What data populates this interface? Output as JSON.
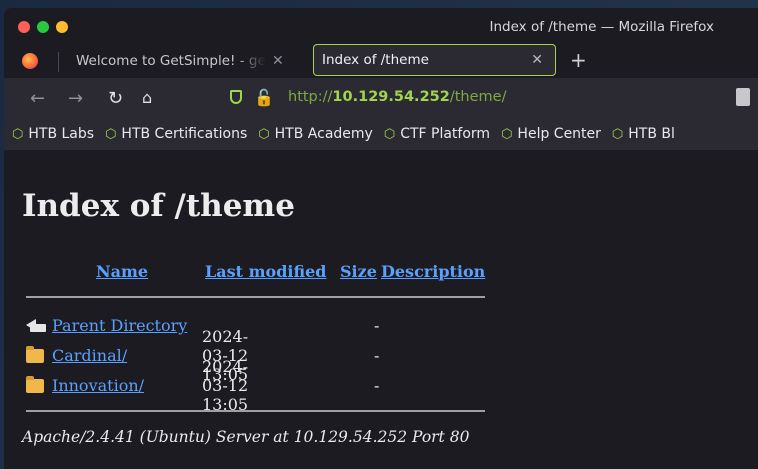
{
  "window": {
    "title": "Index of /theme — Mozilla Firefox"
  },
  "tabs": [
    {
      "label": "Welcome to GetSimple! - getsimple",
      "active": false
    },
    {
      "label": "Index of /theme",
      "active": true
    }
  ],
  "navbar": {
    "url_scheme": "http://",
    "url_host": "10.129.54.252",
    "url_path": "/theme/"
  },
  "bookmarks": [
    {
      "label": "HTB Labs",
      "icon": "htb-cube-icon"
    },
    {
      "label": "HTB Certifications",
      "icon": "htb-cube-icon"
    },
    {
      "label": "HTB Academy",
      "icon": "htb-cube-icon"
    },
    {
      "label": "CTF Platform",
      "icon": "htb-cube-icon"
    },
    {
      "label": "Help Center",
      "icon": "htb-cube-icon"
    },
    {
      "label": "HTB Bl",
      "icon": "htb-cube-icon"
    }
  ],
  "page": {
    "heading": "Index of /theme",
    "columns": [
      "Name",
      "Last modified",
      "Size",
      "Description"
    ],
    "entries": [
      {
        "name": "Parent Directory",
        "modified": "",
        "size": "-",
        "icon": "back-icon"
      },
      {
        "name": "Cardinal/",
        "modified": "2024-03-12 13:05",
        "size": "-",
        "icon": "folder-icon"
      },
      {
        "name": "Innovation/",
        "modified": "2024-03-12 13:05",
        "size": "-",
        "icon": "folder-icon"
      }
    ],
    "footer": "Apache/2.4.41 (Ubuntu) Server at 10.129.54.252 Port 80"
  },
  "colors": {
    "accent": "#a3d44e",
    "link": "#5aa0ff",
    "insecure": "#ff4f5e"
  }
}
